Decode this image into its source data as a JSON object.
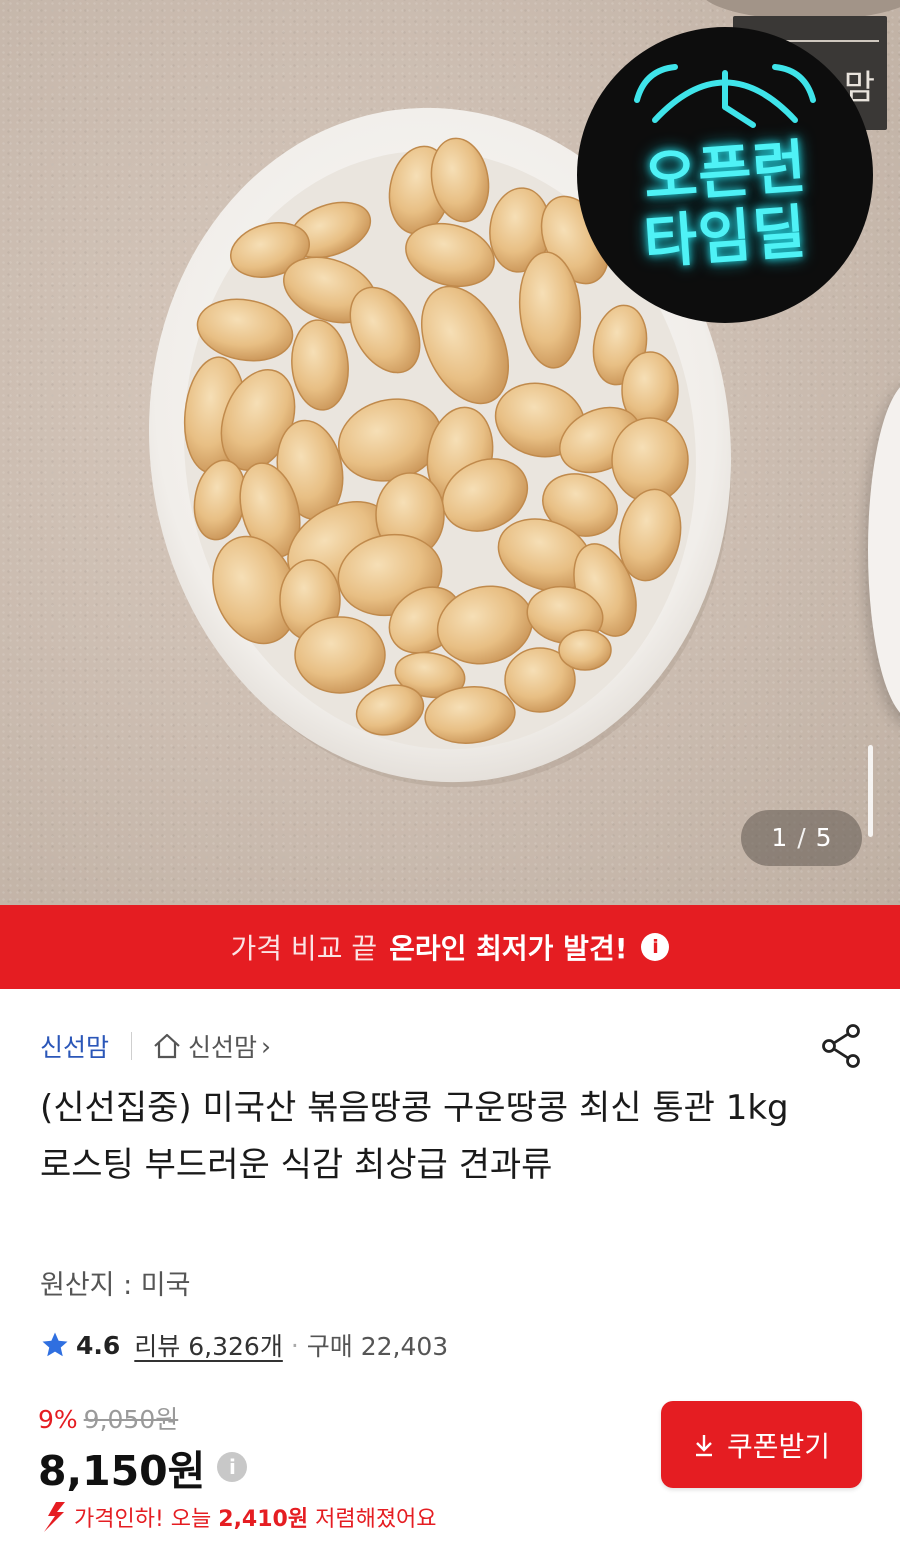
{
  "hero": {
    "brand_watermark": "맘",
    "deal_badge": {
      "line1": "오픈런",
      "line2": "타임딜"
    },
    "page_counter": {
      "current": "1",
      "separator": "/",
      "total": "5"
    }
  },
  "banner": {
    "text_normal": "가격 비교 끝",
    "text_bold": "온라인 최저가 발견!",
    "info_icon": "i"
  },
  "seller": {
    "name": "신선맘",
    "store_name": "신선맘",
    "store_arrow": "›"
  },
  "product": {
    "title": "(신선집중) 미국산 볶음땅콩 구운땅콩 최신 통관 1kg 로스팅 부드러운 식감 최상급 견과류",
    "origin": "원산지 : 미국"
  },
  "rating": {
    "score": "4.6",
    "reviews": "리뷰 6,326개",
    "separator": "·",
    "purchases": "구매 22,403"
  },
  "price": {
    "discount_rate": "9%",
    "original": "9,050원",
    "final": "8,150원",
    "info_icon": "i"
  },
  "price_drop": {
    "prefix": "가격인하! 오늘",
    "amount": "2,410원",
    "suffix": "저렴해졌어요"
  },
  "coupon_button": {
    "label": "쿠폰받기"
  },
  "colors": {
    "accent_red": "#e51d22",
    "link_blue": "#2a56b8",
    "star_blue": "#2f6fe0",
    "neon_cyan": "#4ff2f6"
  },
  "icons": [
    "home-icon",
    "share-icon",
    "star-icon",
    "info-icon",
    "download-icon",
    "price-down-arrow-icon"
  ]
}
